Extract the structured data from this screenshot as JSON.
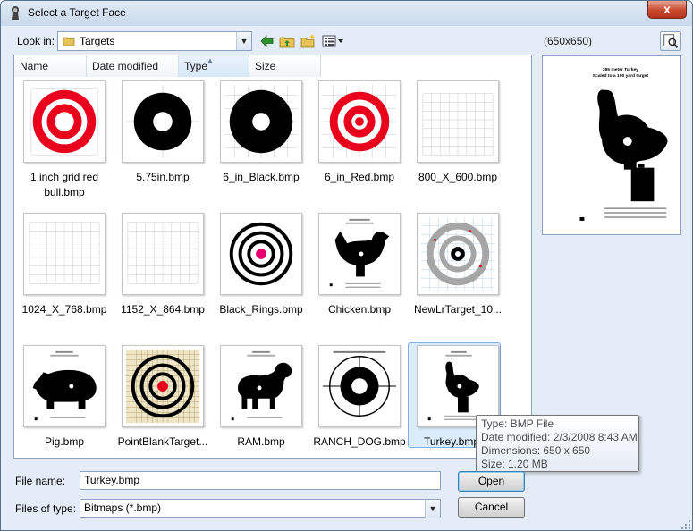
{
  "window": {
    "title": "Select a Target Face",
    "close_label": "x"
  },
  "toolbar": {
    "look_in_label": "Look in:",
    "look_in_value": "Targets",
    "icons": [
      "back-arrow-icon",
      "up-folder-icon",
      "new-folder-icon",
      "view-menu-icon"
    ]
  },
  "preview": {
    "size_text": "(650x650)",
    "image_title_line1": "385 meter Turkey",
    "image_title_line2": "Scaled to a 100 yard target"
  },
  "columns": [
    "Name",
    "Date modified",
    "Type",
    "Size"
  ],
  "files": [
    {
      "name": "1 inch grid red bull.bmp",
      "thumb": "red-bull-grid"
    },
    {
      "name": "5.75in.bmp",
      "thumb": "black-bull"
    },
    {
      "name": "6_in_Black.bmp",
      "thumb": "black-bull-large"
    },
    {
      "name": "6_in_Red.bmp",
      "thumb": "red-bull"
    },
    {
      "name": "800_X_600.bmp",
      "thumb": "grid"
    },
    {
      "name": "1024_X_768.bmp",
      "thumb": "grid"
    },
    {
      "name": "1152_X_864.bmp",
      "thumb": "grid"
    },
    {
      "name": "Black_Rings.bmp",
      "thumb": "black-rings"
    },
    {
      "name": "Chicken.bmp",
      "thumb": "chicken"
    },
    {
      "name": "NewLrTarget_10...",
      "thumb": "lr-target"
    },
    {
      "name": "Pig.bmp",
      "thumb": "pig"
    },
    {
      "name": "PointBlankTarget...",
      "thumb": "pointblank"
    },
    {
      "name": "RAM.bmp",
      "thumb": "ram"
    },
    {
      "name": "RANCH_DOG.bmp",
      "thumb": "ranch-dog"
    },
    {
      "name": "Turkey.bmp",
      "thumb": "turkey",
      "selected": true
    }
  ],
  "tooltip": {
    "type": "Type: BMP File",
    "date": "Date modified: 2/3/2008 8:43 AM",
    "dimensions": "Dimensions: 650 x 650",
    "size": "Size: 1.20 MB"
  },
  "form": {
    "file_name_label": "File name:",
    "file_name_value": "Turkey.bmp",
    "files_of_type_label": "Files of type:",
    "files_of_type_value": "Bitmaps (*.bmp)",
    "open_label": "Open",
    "cancel_label": "Cancel"
  },
  "colors": {
    "accent": "#3c7fb1",
    "target_red": "#e8001c",
    "target_black": "#000000"
  }
}
